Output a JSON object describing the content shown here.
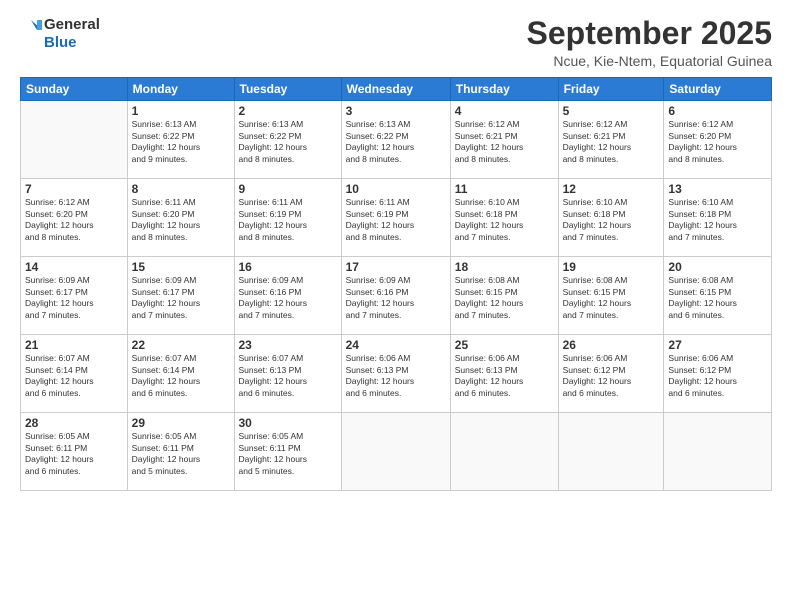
{
  "logo": {
    "line1": "General",
    "line2": "Blue"
  },
  "header": {
    "month": "September 2025",
    "location": "Ncue, Kie-Ntem, Equatorial Guinea"
  },
  "days_of_week": [
    "Sunday",
    "Monday",
    "Tuesday",
    "Wednesday",
    "Thursday",
    "Friday",
    "Saturday"
  ],
  "weeks": [
    [
      {
        "day": "",
        "info": ""
      },
      {
        "day": "1",
        "info": "Sunrise: 6:13 AM\nSunset: 6:22 PM\nDaylight: 12 hours\nand 9 minutes."
      },
      {
        "day": "2",
        "info": "Sunrise: 6:13 AM\nSunset: 6:22 PM\nDaylight: 12 hours\nand 8 minutes."
      },
      {
        "day": "3",
        "info": "Sunrise: 6:13 AM\nSunset: 6:22 PM\nDaylight: 12 hours\nand 8 minutes."
      },
      {
        "day": "4",
        "info": "Sunrise: 6:12 AM\nSunset: 6:21 PM\nDaylight: 12 hours\nand 8 minutes."
      },
      {
        "day": "5",
        "info": "Sunrise: 6:12 AM\nSunset: 6:21 PM\nDaylight: 12 hours\nand 8 minutes."
      },
      {
        "day": "6",
        "info": "Sunrise: 6:12 AM\nSunset: 6:20 PM\nDaylight: 12 hours\nand 8 minutes."
      }
    ],
    [
      {
        "day": "7",
        "info": "Sunrise: 6:12 AM\nSunset: 6:20 PM\nDaylight: 12 hours\nand 8 minutes."
      },
      {
        "day": "8",
        "info": "Sunrise: 6:11 AM\nSunset: 6:20 PM\nDaylight: 12 hours\nand 8 minutes."
      },
      {
        "day": "9",
        "info": "Sunrise: 6:11 AM\nSunset: 6:19 PM\nDaylight: 12 hours\nand 8 minutes."
      },
      {
        "day": "10",
        "info": "Sunrise: 6:11 AM\nSunset: 6:19 PM\nDaylight: 12 hours\nand 8 minutes."
      },
      {
        "day": "11",
        "info": "Sunrise: 6:10 AM\nSunset: 6:18 PM\nDaylight: 12 hours\nand 7 minutes."
      },
      {
        "day": "12",
        "info": "Sunrise: 6:10 AM\nSunset: 6:18 PM\nDaylight: 12 hours\nand 7 minutes."
      },
      {
        "day": "13",
        "info": "Sunrise: 6:10 AM\nSunset: 6:18 PM\nDaylight: 12 hours\nand 7 minutes."
      }
    ],
    [
      {
        "day": "14",
        "info": "Sunrise: 6:09 AM\nSunset: 6:17 PM\nDaylight: 12 hours\nand 7 minutes."
      },
      {
        "day": "15",
        "info": "Sunrise: 6:09 AM\nSunset: 6:17 PM\nDaylight: 12 hours\nand 7 minutes."
      },
      {
        "day": "16",
        "info": "Sunrise: 6:09 AM\nSunset: 6:16 PM\nDaylight: 12 hours\nand 7 minutes."
      },
      {
        "day": "17",
        "info": "Sunrise: 6:09 AM\nSunset: 6:16 PM\nDaylight: 12 hours\nand 7 minutes."
      },
      {
        "day": "18",
        "info": "Sunrise: 6:08 AM\nSunset: 6:15 PM\nDaylight: 12 hours\nand 7 minutes."
      },
      {
        "day": "19",
        "info": "Sunrise: 6:08 AM\nSunset: 6:15 PM\nDaylight: 12 hours\nand 7 minutes."
      },
      {
        "day": "20",
        "info": "Sunrise: 6:08 AM\nSunset: 6:15 PM\nDaylight: 12 hours\nand 6 minutes."
      }
    ],
    [
      {
        "day": "21",
        "info": "Sunrise: 6:07 AM\nSunset: 6:14 PM\nDaylight: 12 hours\nand 6 minutes."
      },
      {
        "day": "22",
        "info": "Sunrise: 6:07 AM\nSunset: 6:14 PM\nDaylight: 12 hours\nand 6 minutes."
      },
      {
        "day": "23",
        "info": "Sunrise: 6:07 AM\nSunset: 6:13 PM\nDaylight: 12 hours\nand 6 minutes."
      },
      {
        "day": "24",
        "info": "Sunrise: 6:06 AM\nSunset: 6:13 PM\nDaylight: 12 hours\nand 6 minutes."
      },
      {
        "day": "25",
        "info": "Sunrise: 6:06 AM\nSunset: 6:13 PM\nDaylight: 12 hours\nand 6 minutes."
      },
      {
        "day": "26",
        "info": "Sunrise: 6:06 AM\nSunset: 6:12 PM\nDaylight: 12 hours\nand 6 minutes."
      },
      {
        "day": "27",
        "info": "Sunrise: 6:06 AM\nSunset: 6:12 PM\nDaylight: 12 hours\nand 6 minutes."
      }
    ],
    [
      {
        "day": "28",
        "info": "Sunrise: 6:05 AM\nSunset: 6:11 PM\nDaylight: 12 hours\nand 6 minutes."
      },
      {
        "day": "29",
        "info": "Sunrise: 6:05 AM\nSunset: 6:11 PM\nDaylight: 12 hours\nand 5 minutes."
      },
      {
        "day": "30",
        "info": "Sunrise: 6:05 AM\nSunset: 6:11 PM\nDaylight: 12 hours\nand 5 minutes."
      },
      {
        "day": "",
        "info": ""
      },
      {
        "day": "",
        "info": ""
      },
      {
        "day": "",
        "info": ""
      },
      {
        "day": "",
        "info": ""
      }
    ]
  ]
}
